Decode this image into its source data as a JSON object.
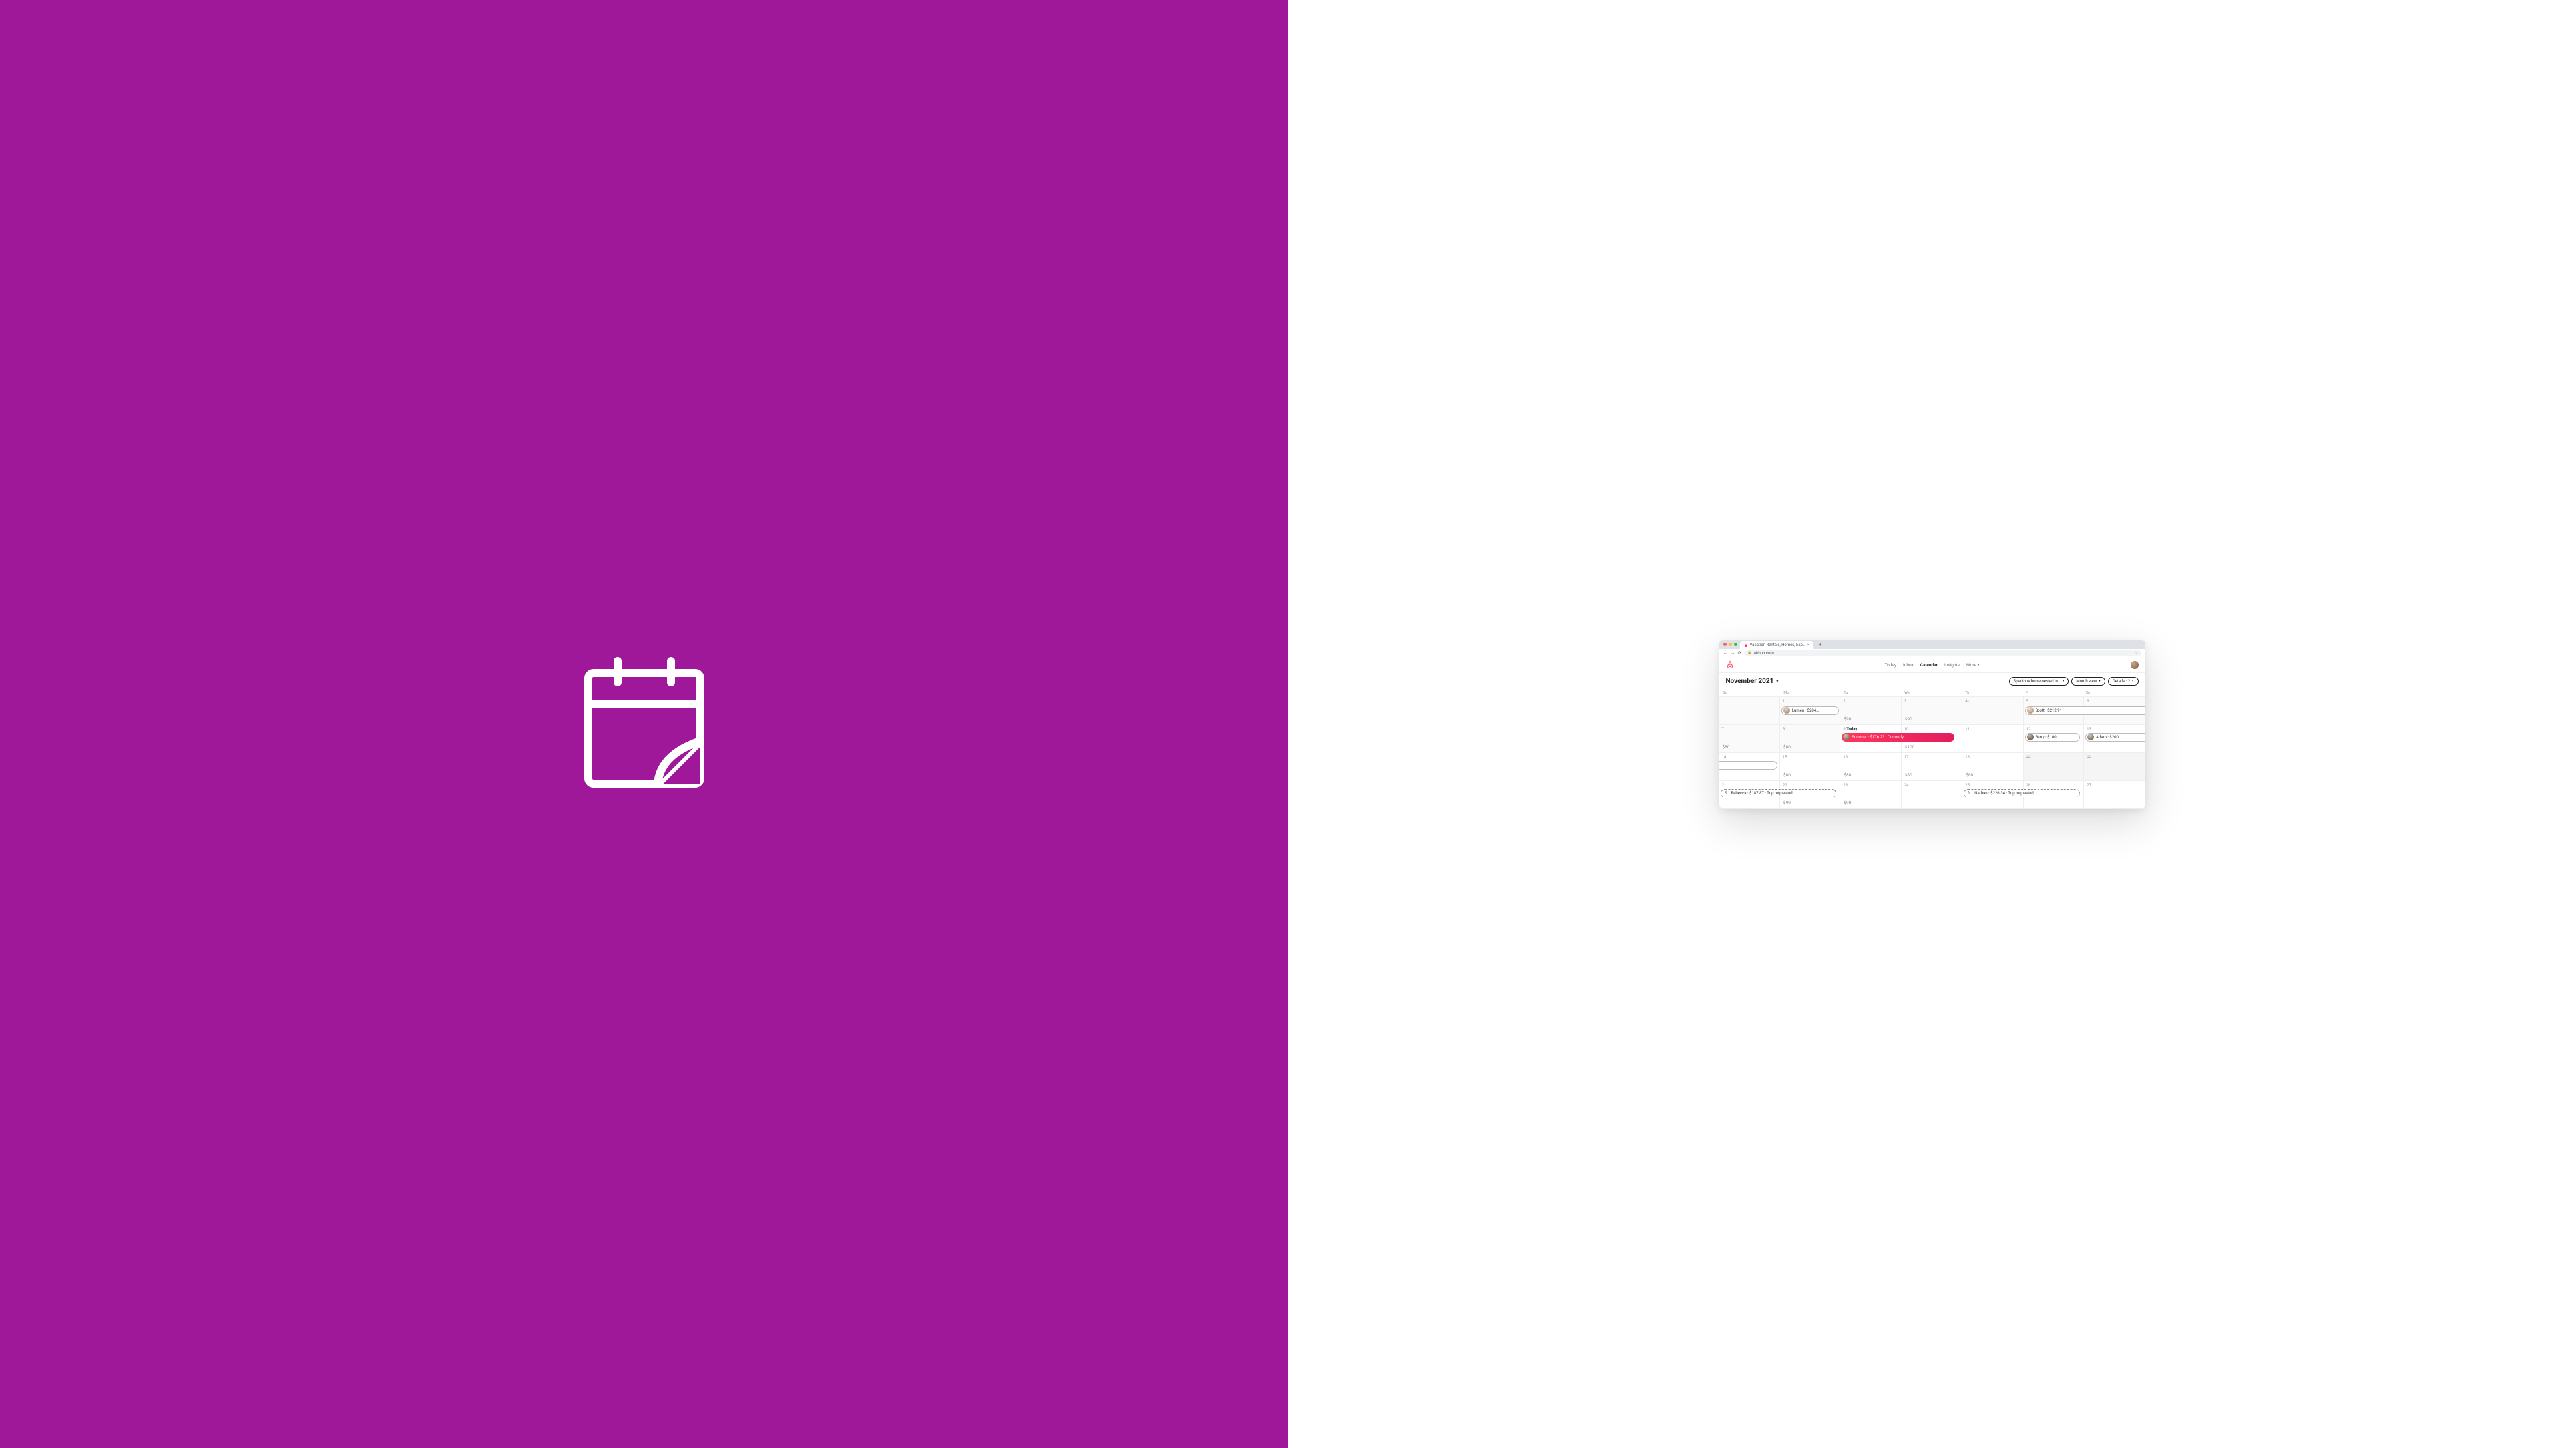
{
  "left_panel": {
    "icon": "calendar-note-icon"
  },
  "browser": {
    "tab_title": "Vacation Rentals, Homes, Exp…",
    "url": "airbnb.com"
  },
  "header": {
    "nav": {
      "today": "Today",
      "inbox": "Inbox",
      "calendar": "Calendar",
      "insights": "Insights",
      "more": "More"
    }
  },
  "subheader": {
    "month_label": "November 2021",
    "listing_pill": "Spacious home nested in…",
    "view_pill": "Month view",
    "details_pill": "Details · 2"
  },
  "dow": [
    "Su",
    "Mo",
    "Tu",
    "We",
    "Th",
    "Fr",
    "Sa"
  ],
  "cells": {
    "r0": [
      {
        "num": "",
        "dim": true
      },
      {
        "num": "1",
        "dim": true
      },
      {
        "num": "2",
        "dim": true,
        "price": "$90"
      },
      {
        "num": "3",
        "dim": true,
        "price": "$90"
      },
      {
        "num": "4",
        "dim": true,
        "line": true
      },
      {
        "num": "5",
        "dim": true
      },
      {
        "num": "6",
        "dim": true
      }
    ],
    "r1": [
      {
        "num": "7",
        "dim": true,
        "price": "$80"
      },
      {
        "num": "8",
        "dim": true,
        "price": "$80"
      },
      {
        "num": "9",
        "today": "Today"
      },
      {
        "num": "10",
        "price": "$100"
      },
      {
        "num": "11"
      },
      {
        "num": "12"
      },
      {
        "num": "13"
      }
    ],
    "r2": [
      {
        "num": "14"
      },
      {
        "num": "15",
        "price": "$80"
      },
      {
        "num": "16",
        "price": "$80"
      },
      {
        "num": "17",
        "price": "$80"
      },
      {
        "num": "18",
        "price": "$80"
      },
      {
        "num": "19",
        "blocked": true
      },
      {
        "num": "20",
        "blocked": true
      }
    ],
    "r3": [
      {
        "num": "21"
      },
      {
        "num": "22",
        "price": "$90"
      },
      {
        "num": "23",
        "price": "$90"
      },
      {
        "num": "24"
      },
      {
        "num": "25"
      },
      {
        "num": "26"
      },
      {
        "num": "27"
      }
    ]
  },
  "bookings": {
    "lumen": "Lumen · $204…",
    "scott": "Scott · $212.91",
    "summer": "Summer · $176.23 · Currently",
    "barry": "Barry · $100…",
    "adam": "Adam · $200…",
    "rebecca": "Rebecca · $187.87 · Trip requested",
    "nathan": "Nathan · $226.34 · Trip requested",
    "rebecca_initial": "R",
    "nathan_initial": "N"
  }
}
